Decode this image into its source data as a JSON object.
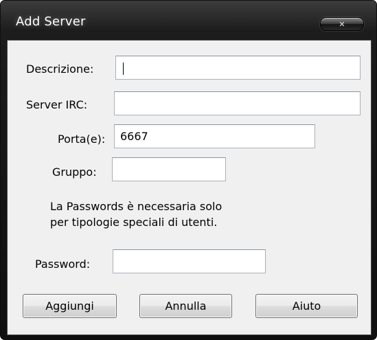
{
  "window": {
    "title": "Add Server",
    "close_icon": "close-icon"
  },
  "form": {
    "descrizione": {
      "label": "Descrizione:",
      "value": ""
    },
    "server_irc": {
      "label": "Server IRC:",
      "value": ""
    },
    "porta": {
      "label": "Porta(e):",
      "value": "6667"
    },
    "gruppo": {
      "label": "Gruppo:",
      "value": ""
    },
    "note_line1": "La Passwords è necessaria solo",
    "note_line2": "per tipologie speciali di utenti.",
    "password": {
      "label": "Password:",
      "value": ""
    }
  },
  "buttons": {
    "aggiungi": "Aggiungi",
    "annulla": "Annulla",
    "aiuto": "Aiuto"
  }
}
